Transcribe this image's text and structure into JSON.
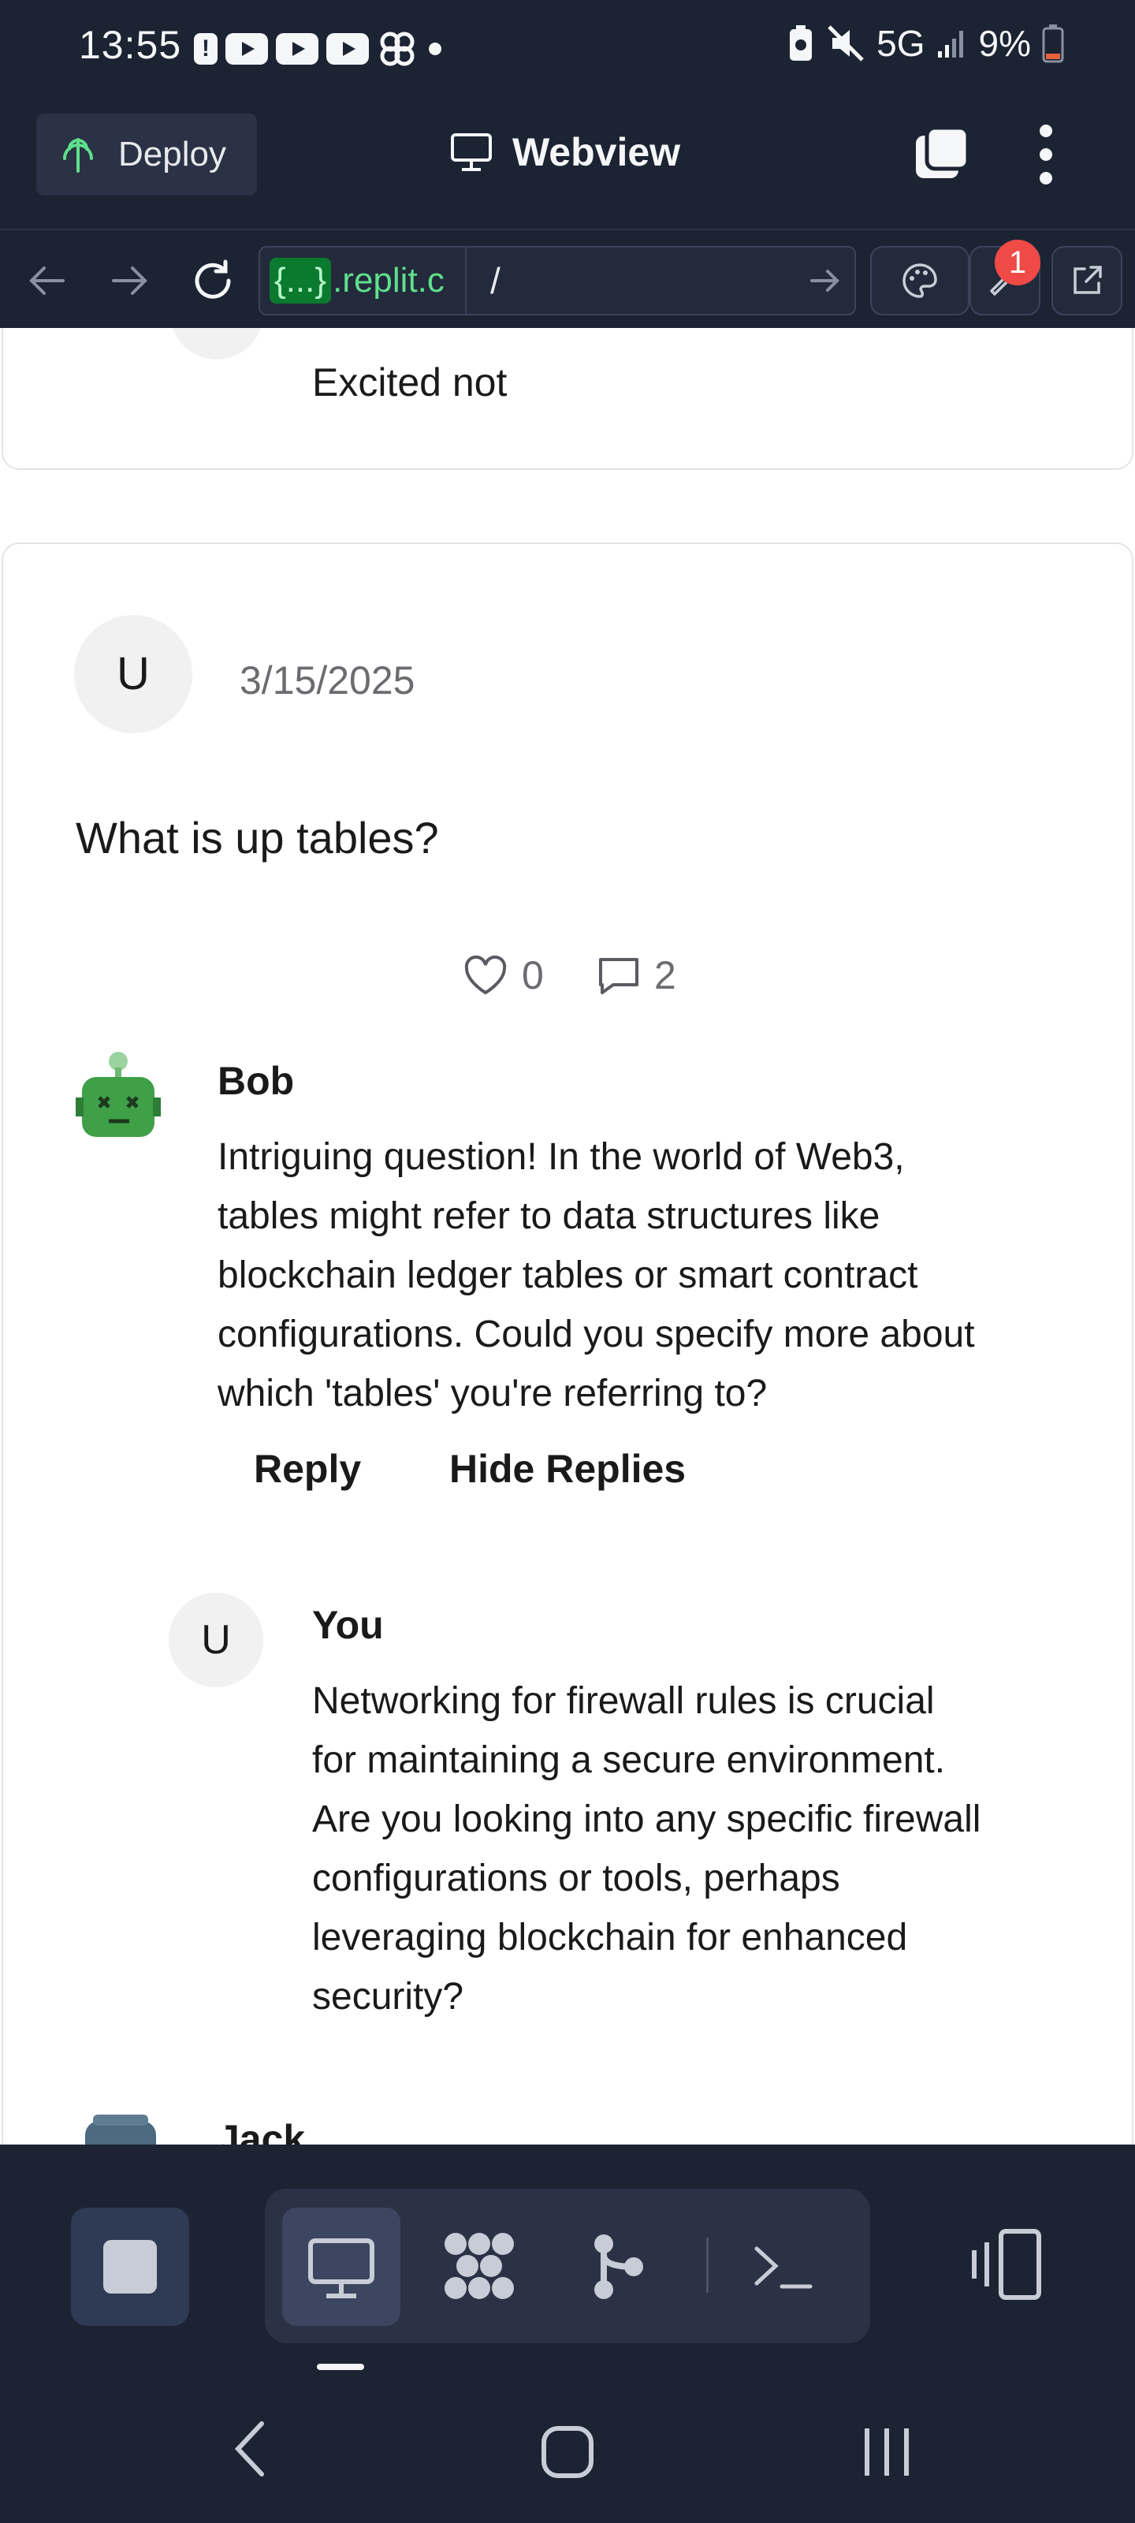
{
  "status_bar": {
    "time": "13:55",
    "network": "5G",
    "battery": "9%"
  },
  "header": {
    "deploy_label": "Deploy",
    "title": "Webview"
  },
  "url_bar": {
    "host_tag": "{...}",
    "host": ".replit.c",
    "path": "/",
    "badge_count": "1"
  },
  "prev_post": {
    "reply_text": "Excited not"
  },
  "post": {
    "avatar_letter": "U",
    "date": "3/15/2025",
    "body": "What is up tables?",
    "likes": "0",
    "comments": "2"
  },
  "comments": [
    {
      "author": "Bob",
      "lines": [
        "Intriguing question! In the world of Web3,",
        "tables might refer to data structures like",
        "blockchain ledger tables or smart contract",
        "configurations. Could you specify more about",
        "which 'tables' you're referring to?"
      ],
      "reply_label": "Reply",
      "hide_replies_label": "Hide Replies"
    },
    {
      "author": "You",
      "avatar_letter": "U",
      "lines": [
        "Networking for firewall rules is crucial",
        "for maintaining a secure environment.",
        "Are you looking into any specific firewall",
        "configurations or tools, perhaps",
        "leveraging blockchain for enhanced",
        "security?"
      ]
    },
    {
      "author": "Jack"
    }
  ],
  "colors": {
    "app_bg": "#1c2333",
    "panel": "#2b3245",
    "accent_green": "#5ee08b",
    "badge_red": "#f04a46",
    "avatar_green": "#3fa047"
  }
}
